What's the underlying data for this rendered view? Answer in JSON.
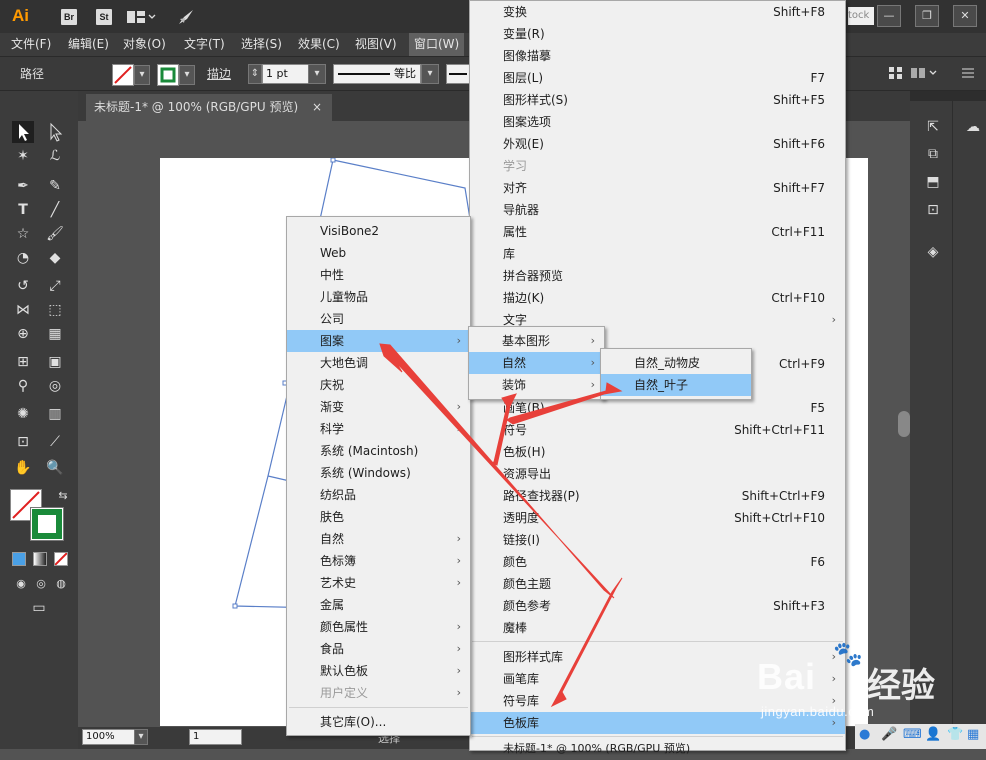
{
  "titlebar": {
    "app_logo": "Ai",
    "bridge_label": "Br",
    "stock_label": "St",
    "stock_search_placeholder": "tock",
    "minimize": "—",
    "restore": "❐",
    "close": "✕"
  },
  "menubar": {
    "items": [
      "文件(F)",
      "编辑(E)",
      "对象(O)",
      "文字(T)",
      "选择(S)",
      "效果(C)",
      "视图(V)",
      "窗口(W)"
    ]
  },
  "controlbar": {
    "selection_label": "路径",
    "stroke_label": "描边",
    "stroke_weight": "1 pt",
    "stroke_profile": "等比"
  },
  "document": {
    "tab_title": "未标题-1* @ 100% (RGB/GPU 预览)",
    "tab_close": "×"
  },
  "statusbar": {
    "zoom": "100%",
    "artboard": "1",
    "status": "选择",
    "bottom_tab": "未标题-1* @ 100% (RGB/GPU 预览)"
  },
  "window_menu": {
    "items": [
      {
        "label": "变换",
        "shortcut": "Shift+F8"
      },
      {
        "label": "变量(R)",
        "shortcut": ""
      },
      {
        "label": "图像描摹",
        "shortcut": ""
      },
      {
        "label": "图层(L)",
        "shortcut": "F7"
      },
      {
        "label": "图形样式(S)",
        "shortcut": "Shift+F5"
      },
      {
        "label": "图案选项",
        "shortcut": ""
      },
      {
        "label": "外观(E)",
        "shortcut": "Shift+F6"
      },
      {
        "label": "学习",
        "shortcut": ""
      },
      {
        "label": "对齐",
        "shortcut": "Shift+F7"
      },
      {
        "label": "导航器",
        "shortcut": ""
      },
      {
        "label": "属性",
        "shortcut": "Ctrl+F11"
      },
      {
        "label": "库",
        "shortcut": ""
      },
      {
        "label": "拼合器预览",
        "shortcut": ""
      },
      {
        "label": "描边(K)",
        "shortcut": "Ctrl+F10"
      },
      {
        "label": "文字",
        "shortcut": ""
      },
      {
        "label": "",
        "shortcut": ""
      },
      {
        "label": "",
        "shortcut": "Ctrl+F9"
      },
      {
        "label": "",
        "shortcut": ""
      },
      {
        "label": "画笔(B)",
        "shortcut": "F5"
      },
      {
        "label": "符号",
        "shortcut": "Shift+Ctrl+F11"
      },
      {
        "label": "色板(H)",
        "shortcut": ""
      },
      {
        "label": "资源导出",
        "shortcut": ""
      },
      {
        "label": "路径查找器(P)",
        "shortcut": "Shift+Ctrl+F9"
      },
      {
        "label": "透明度",
        "shortcut": "Shift+Ctrl+F10"
      },
      {
        "label": "链接(I)",
        "shortcut": ""
      },
      {
        "label": "颜色",
        "shortcut": "F6"
      },
      {
        "label": "颜色主题",
        "shortcut": ""
      },
      {
        "label": "颜色参考",
        "shortcut": "Shift+F3"
      },
      {
        "label": "魔棒",
        "shortcut": ""
      },
      {
        "label": "图形样式库",
        "shortcut": ""
      },
      {
        "label": "画笔库",
        "shortcut": ""
      },
      {
        "label": "符号库",
        "shortcut": ""
      },
      {
        "label": "色板库",
        "shortcut": ""
      }
    ],
    "bottom_doc": "未标题-1* @ 100% (RGB/GPU 预览)"
  },
  "swatch_library_menu": {
    "items": [
      {
        "label": "VisiBone2"
      },
      {
        "label": "Web"
      },
      {
        "label": "中性"
      },
      {
        "label": "儿童物品"
      },
      {
        "label": "公司"
      },
      {
        "label": "图案"
      },
      {
        "label": "大地色调"
      },
      {
        "label": "庆祝"
      },
      {
        "label": "渐变"
      },
      {
        "label": "科学"
      },
      {
        "label": "系统 (Macintosh)"
      },
      {
        "label": "系统 (Windows)"
      },
      {
        "label": "纺织品"
      },
      {
        "label": "肤色"
      },
      {
        "label": "自然"
      },
      {
        "label": "色标簿"
      },
      {
        "label": "艺术史"
      },
      {
        "label": "金属"
      },
      {
        "label": "颜色属性"
      },
      {
        "label": "食品"
      },
      {
        "label": "默认色板"
      },
      {
        "label": "用户定义"
      },
      {
        "label": "其它库(O)..."
      }
    ]
  },
  "pattern_menu": {
    "items": [
      {
        "label": "基本图形"
      },
      {
        "label": "自然"
      },
      {
        "label": "装饰"
      }
    ]
  },
  "nature_menu": {
    "items": [
      {
        "label": "自然_动物皮"
      },
      {
        "label": "自然_叶子"
      }
    ]
  },
  "watermark": {
    "brand": "Bai",
    "brand_cn": "经验",
    "url": "jingyan.baidu.com"
  },
  "colors": {
    "highlight": "#91c9f7",
    "annotation_arrow": "#e8403a",
    "path_stroke": "#5a7fc8"
  }
}
